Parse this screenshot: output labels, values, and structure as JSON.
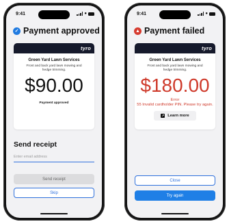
{
  "status_bar": {
    "time": "9:41"
  },
  "colors": {
    "accent": "#1f7ae0",
    "error": "#cf3a2b",
    "brand_bar": "#161a2c"
  },
  "approved_screen": {
    "title": "Payment approved",
    "icon": "check-circle-icon",
    "brand": "tyro",
    "merchant": "Green Yard Lawn Services",
    "description": "Front and back yard lawn mowing and hedge trimming.",
    "amount": "$90.00",
    "status": "Payment approved",
    "receipt_title": "Send receipt",
    "email_placeholder": "Enter email address",
    "send_label": "Send receipt",
    "skip_label": "Skip"
  },
  "failed_screen": {
    "title": "Payment failed",
    "icon": "error-circle-icon",
    "brand": "tyro",
    "merchant": "Green Yard Lawn Services",
    "description": "Front and back yard lawn mowing and hedge trimming.",
    "amount": "$180.00",
    "error_title": "Error",
    "error_message": "55 Invalid cardholder PIN. Please try again.",
    "learn_more_label": "Learn more",
    "close_label": "Close",
    "try_again_label": "Try again"
  }
}
